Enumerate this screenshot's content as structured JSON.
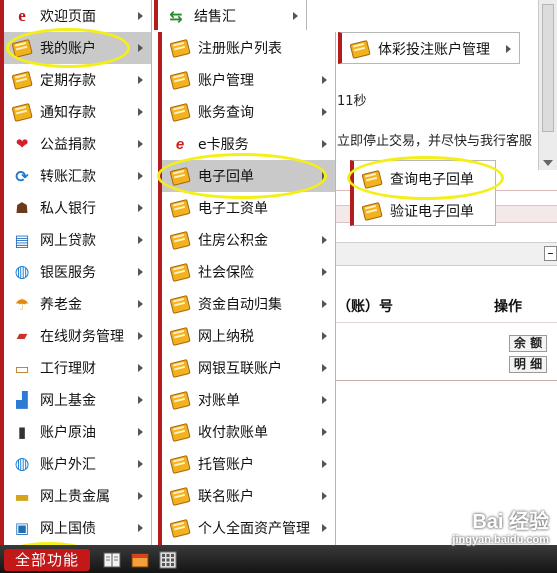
{
  "background": {
    "timer_text": "11秒",
    "warning_text": "立即停止交易，并尽快与我行客服",
    "account_col_header": "（账）号",
    "action_col_header": "操作",
    "minus_btn": "–",
    "balance_btn": "余 额",
    "detail_btn": "明 细"
  },
  "menu_level1": [
    {
      "label": "欢迎页面",
      "icon": "e-logo-icon",
      "arrow": true
    },
    {
      "label": "我的账户",
      "icon": "book-icon",
      "arrow": true,
      "highlighted": true
    },
    {
      "label": "定期存款",
      "icon": "book-icon",
      "arrow": true
    },
    {
      "label": "通知存款",
      "icon": "book-icon",
      "arrow": true
    },
    {
      "label": "公益捐款",
      "icon": "heart-gift-icon",
      "arrow": true
    },
    {
      "label": "转账汇款",
      "icon": "transfer-icon",
      "arrow": true
    },
    {
      "label": "私人银行",
      "icon": "person-icon",
      "arrow": true
    },
    {
      "label": "网上贷款",
      "icon": "document-icon",
      "arrow": true
    },
    {
      "label": "银医服务",
      "icon": "globe-icon",
      "arrow": true
    },
    {
      "label": "养老金",
      "icon": "umbrella-icon",
      "arrow": true
    },
    {
      "label": "在线财务管理",
      "icon": "folder-icon",
      "arrow": true
    },
    {
      "label": "工行理财",
      "icon": "wallet-icon",
      "arrow": true
    },
    {
      "label": "网上基金",
      "icon": "chart-icon",
      "arrow": true
    },
    {
      "label": "账户原油",
      "icon": "oil-icon",
      "arrow": true
    },
    {
      "label": "账户外汇",
      "icon": "globe-icon",
      "arrow": true
    },
    {
      "label": "网上贵金属",
      "icon": "gold-icon",
      "arrow": true
    },
    {
      "label": "网上国债",
      "icon": "bond-icon",
      "arrow": true
    }
  ],
  "menu_level2_top": {
    "label": "结售汇",
    "icon": "exchange-icon",
    "arrow": true
  },
  "menu_level2": [
    {
      "label": "注册账户列表",
      "icon": "book-icon",
      "arrow": false
    },
    {
      "label": "账户管理",
      "icon": "book-icon",
      "arrow": true
    },
    {
      "label": "账务查询",
      "icon": "book-icon",
      "arrow": true
    },
    {
      "label": "e卡服务",
      "icon": "ecard-icon",
      "arrow": true
    },
    {
      "label": "电子回单",
      "icon": "book-icon",
      "arrow": true,
      "highlighted": true
    },
    {
      "label": "电子工资单",
      "icon": "book-icon",
      "arrow": false
    },
    {
      "label": "住房公积金",
      "icon": "book-icon",
      "arrow": true
    },
    {
      "label": "社会保险",
      "icon": "book-icon",
      "arrow": true
    },
    {
      "label": "资金自动归集",
      "icon": "book-icon",
      "arrow": true
    },
    {
      "label": "网上纳税",
      "icon": "book-icon",
      "arrow": true
    },
    {
      "label": "网银互联账户",
      "icon": "book-icon",
      "arrow": true
    },
    {
      "label": "对账单",
      "icon": "book-icon",
      "arrow": true
    },
    {
      "label": "收付款账单",
      "icon": "book-icon",
      "arrow": true
    },
    {
      "label": "托管账户",
      "icon": "book-icon",
      "arrow": true
    },
    {
      "label": "联名账户",
      "icon": "book-icon",
      "arrow": true
    },
    {
      "label": "个人全面资产管理",
      "icon": "book-icon",
      "arrow": true
    }
  ],
  "menu_level3_top": {
    "label": "体彩投注账户管理",
    "icon": "book-icon",
    "arrow": true
  },
  "menu_level3": [
    {
      "label": "查询电子回单",
      "icon": "book-icon"
    },
    {
      "label": "验证电子回单",
      "icon": "book-icon"
    }
  ],
  "taskbar": {
    "start_label": "全部功能"
  },
  "watermark": {
    "brand": "Bai 经验",
    "url": "jingyan.baidu.com"
  },
  "colors": {
    "menu_accent": "#b21c1c",
    "highlight_ring": "#f5ef18",
    "selected_row": "#c9c9c9",
    "start_button": "#c31818"
  }
}
